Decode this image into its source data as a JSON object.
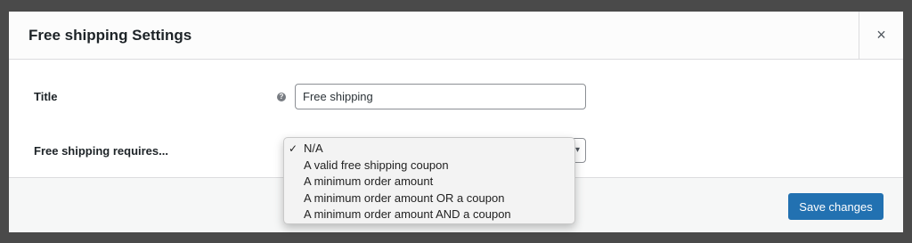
{
  "modal": {
    "title": "Free shipping Settings",
    "close_glyph": "×"
  },
  "form": {
    "title_label": "Title",
    "title_value": "Free shipping",
    "help_glyph": "?",
    "requires_label": "Free shipping requires..."
  },
  "dropdown": {
    "selected_index": 0,
    "check_glyph": "✓",
    "options": [
      "N/A",
      "A valid free shipping coupon",
      "A minimum order amount",
      "A minimum order amount OR a coupon",
      "A minimum order amount AND a coupon"
    ]
  },
  "footer": {
    "save_label": "Save changes"
  },
  "colors": {
    "backdrop": "#4a4a4a",
    "primary_button": "#2271b1",
    "footer_bg": "#f6f7f7"
  },
  "icons": {
    "close": "close-icon",
    "help": "help-icon",
    "dropdown_arrow": "chevron-down-icon",
    "check": "checkmark-icon"
  }
}
